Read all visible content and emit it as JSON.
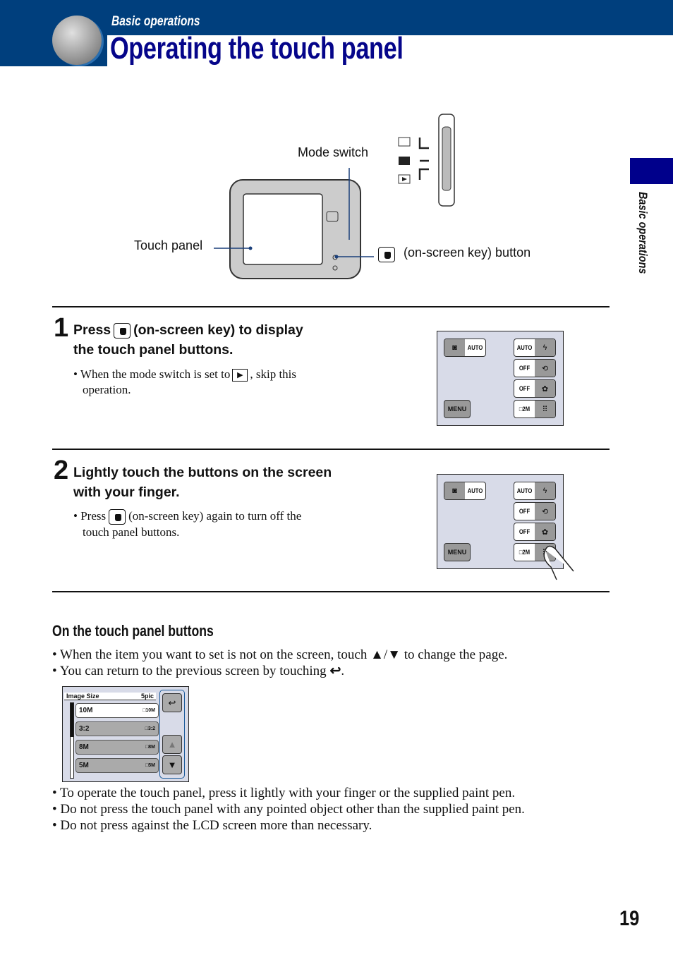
{
  "header": {
    "category": "Basic operations",
    "title": "Operating the touch panel",
    "icon": "camera-section-icon"
  },
  "side_tab": {
    "label": "Basic operations"
  },
  "diagram": {
    "mode_switch_label": "Mode switch",
    "touch_panel_label": "Touch panel",
    "onscreen_key_label": "(on-screen key) button",
    "mode_icons": [
      "movie-icon",
      "camera-icon",
      "playback-icon"
    ]
  },
  "steps": [
    {
      "number": "1",
      "title_pre": "Press",
      "title_post": "(on-screen key) to display",
      "title_line2": "the touch panel buttons.",
      "note_pre": "• When the mode switch is set to",
      "note_post": ", skip this",
      "note_line2": "operation."
    },
    {
      "number": "2",
      "title_line1": "Lightly touch the buttons on the screen",
      "title_line2": "with your finger.",
      "note_pre": "• Press",
      "note_post": "(on-screen key) again to turn off the",
      "note_line2": "touch panel buttons."
    }
  ],
  "panel": {
    "camera_mode": "AUTO",
    "menu": "MENU",
    "right_buttons": [
      {
        "value": "AUTO",
        "icon": "flash-icon",
        "glyph": "ϟ"
      },
      {
        "value": "OFF",
        "icon": "self-timer-icon",
        "glyph": "⟲"
      },
      {
        "value": "OFF",
        "icon": "macro-icon",
        "glyph": "✿"
      },
      {
        "value": "□2M",
        "icon": "image-size-icon",
        "glyph": "⠿"
      }
    ]
  },
  "section": {
    "heading": "On the touch panel buttons",
    "bullets_top": [
      "• When the item you want to set is not on the screen, touch ▲/▼ to change the page.",
      "• You can return to the previous screen by touching"
    ],
    "bullets_bottom": [
      "• To operate the touch panel, press it lightly with your finger or the supplied paint pen.",
      "• Do not press the touch panel with any pointed object other than the supplied paint pen.",
      "• Do not press against the LCD screen more than necessary."
    ]
  },
  "image_size_menu": {
    "title": "Image Size",
    "count": "5pic",
    "items": [
      {
        "label": "10M",
        "tag": "□10M",
        "selected": true
      },
      {
        "label": "3:2",
        "tag": "□3:2",
        "selected": false
      },
      {
        "label": "8M",
        "tag": "□8M",
        "selected": false
      },
      {
        "label": "5M",
        "tag": "□5M",
        "selected": false
      }
    ],
    "back_glyph": "↩",
    "up_glyph": "▲",
    "down_glyph": "▼"
  },
  "page_number": "19"
}
